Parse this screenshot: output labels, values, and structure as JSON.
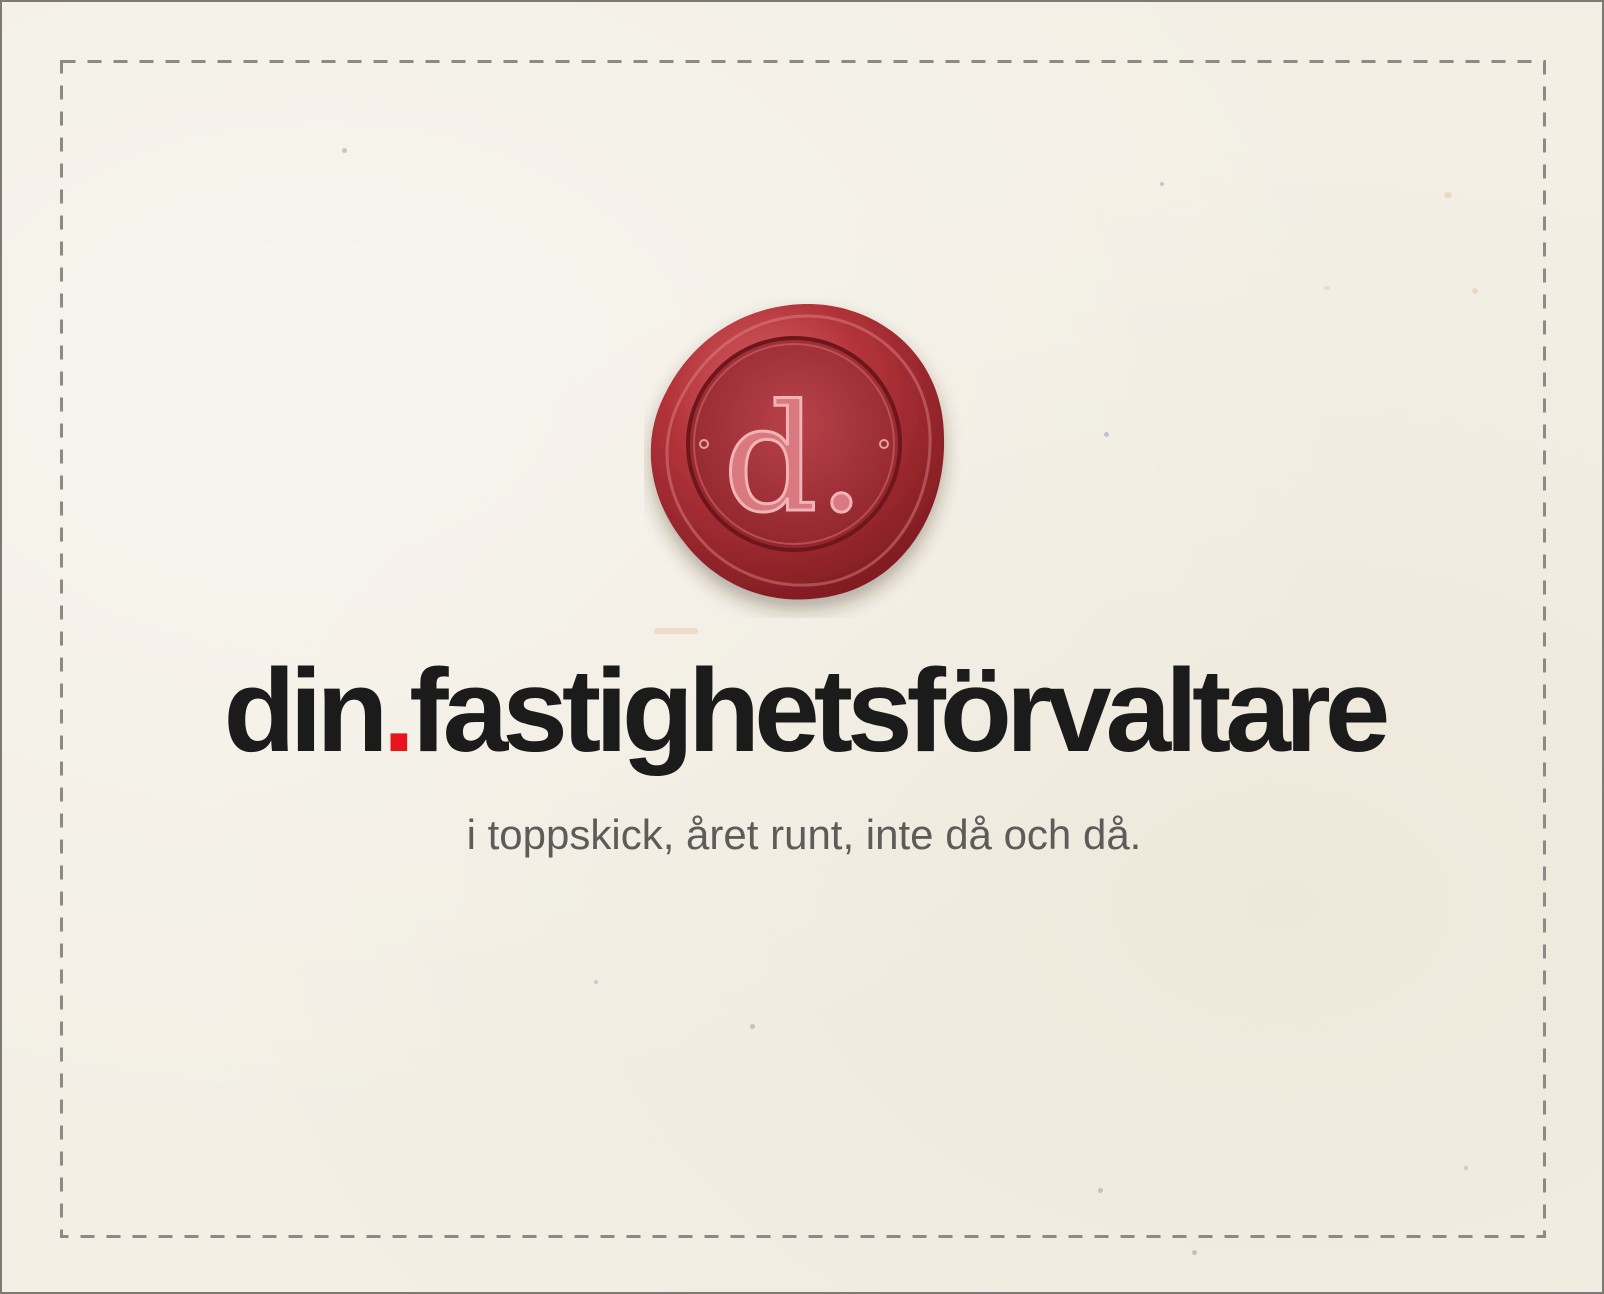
{
  "brand": {
    "name_part1": "din",
    "name_dot": ".",
    "name_part2": "fastighetsförvaltare",
    "seal_letter": "d."
  },
  "tagline": "i toppskick, året runt, inte då och då.",
  "colors": {
    "background": "#f3efe5",
    "text": "#1b1b1b",
    "accent_dot": "#e8141b",
    "tagline": "#5e5c58",
    "wax": "#b3343a",
    "frame_dash": "#8c8a85"
  }
}
